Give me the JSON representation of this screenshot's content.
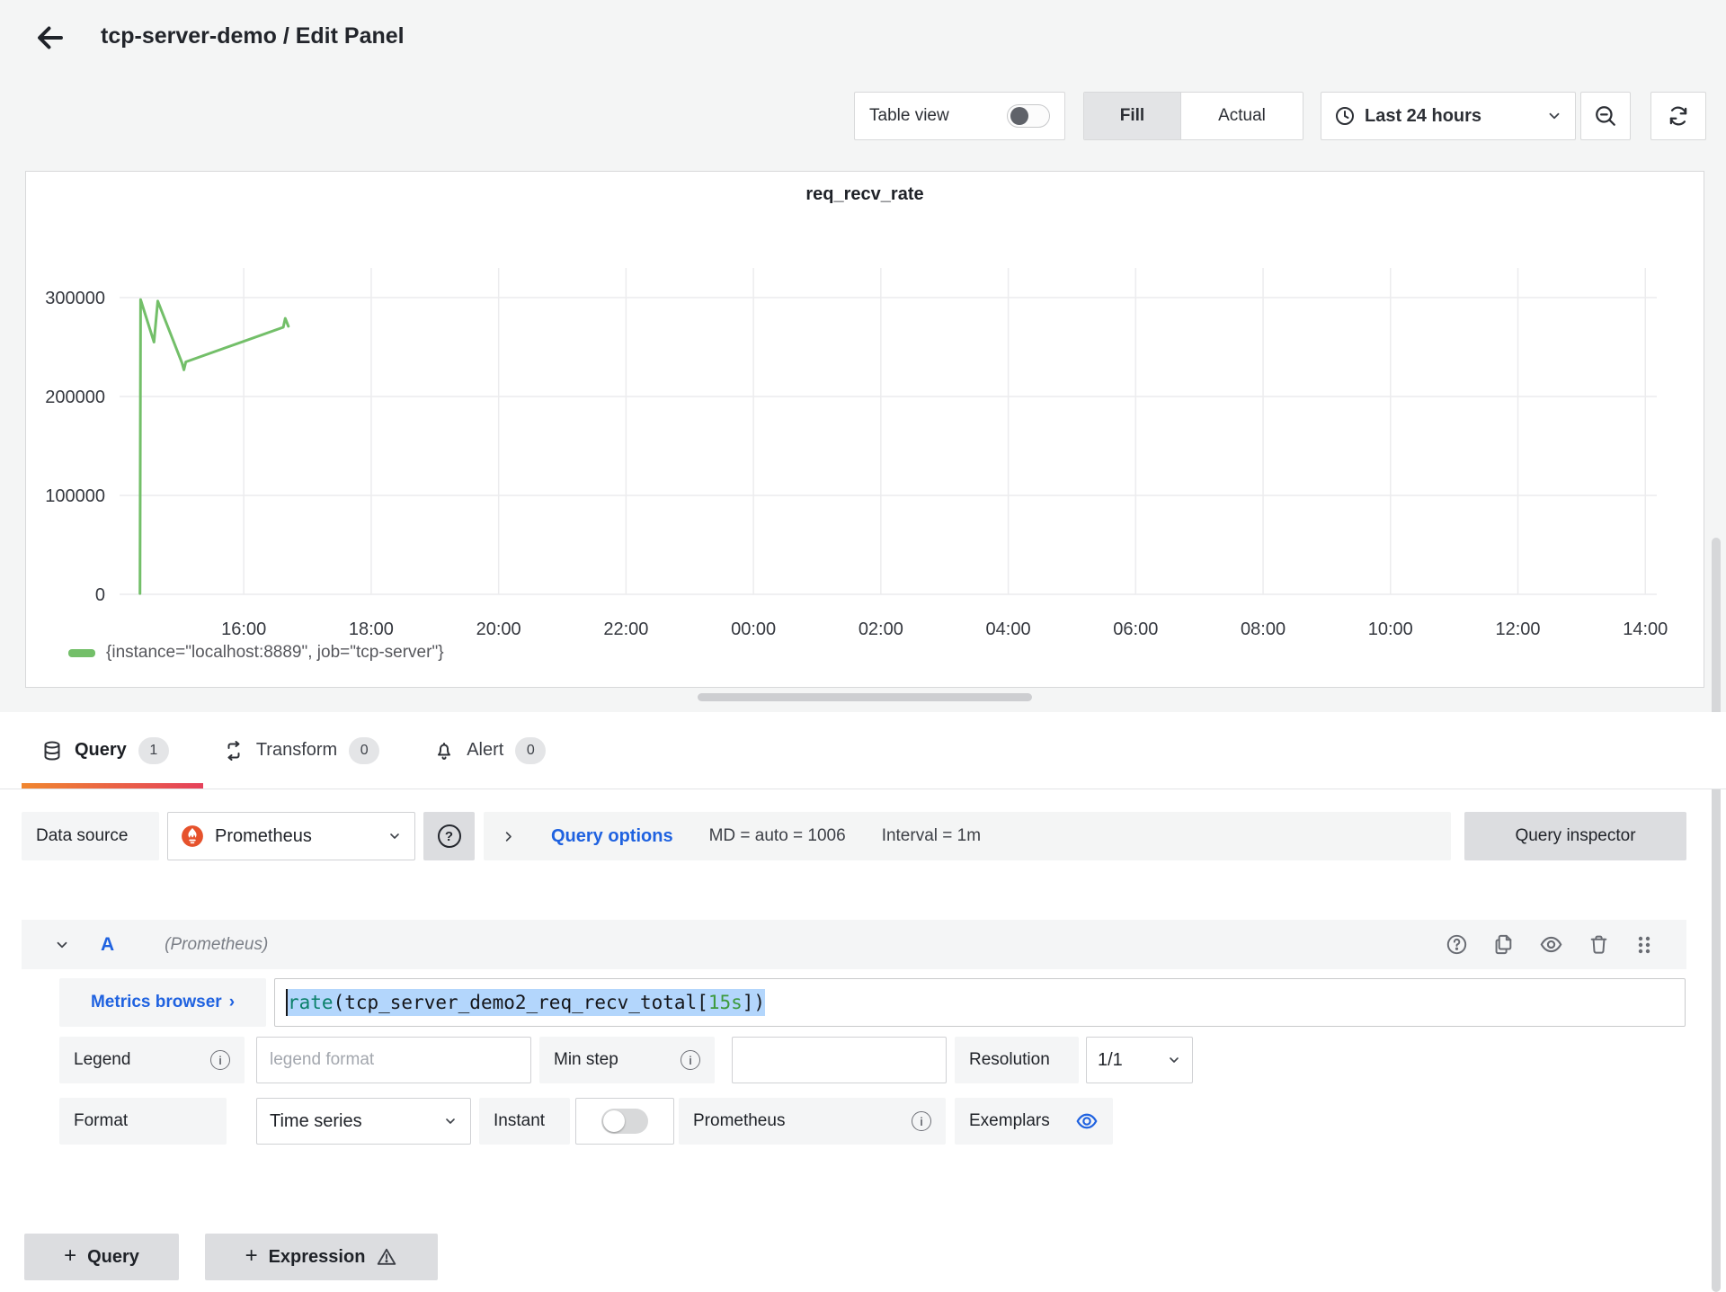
{
  "header": {
    "title": "tcp-server-demo / Edit Panel"
  },
  "toolbar": {
    "table_view_label": "Table view",
    "fill_label": "Fill",
    "actual_label": "Actual",
    "time_range_label": "Last 24 hours"
  },
  "chart_data": {
    "type": "line",
    "title": "req_recv_rate",
    "xlabel": "",
    "ylabel": "",
    "grid": true,
    "legend_position": "bottom",
    "x_range": [
      14.05,
      38.18
    ],
    "y_range": [
      0,
      330000
    ],
    "x_ticks": [
      {
        "h": 16,
        "label": "16:00"
      },
      {
        "h": 18,
        "label": "18:00"
      },
      {
        "h": 20,
        "label": "20:00"
      },
      {
        "h": 22,
        "label": "22:00"
      },
      {
        "h": 24,
        "label": "00:00"
      },
      {
        "h": 26,
        "label": "02:00"
      },
      {
        "h": 28,
        "label": "04:00"
      },
      {
        "h": 30,
        "label": "06:00"
      },
      {
        "h": 32,
        "label": "08:00"
      },
      {
        "h": 34,
        "label": "10:00"
      },
      {
        "h": 36,
        "label": "12:00"
      },
      {
        "h": 38,
        "label": "14:00"
      }
    ],
    "y_ticks": [
      {
        "v": 0,
        "label": "0"
      },
      {
        "v": 100000,
        "label": "100000"
      },
      {
        "v": 200000,
        "label": "200000"
      },
      {
        "v": 300000,
        "label": "300000"
      }
    ],
    "series": [
      {
        "name": "{instance=\"localhost:8889\", job=\"tcp-server\"}",
        "color": "#73bf69",
        "points": [
          {
            "h": 14.37,
            "v": 800
          },
          {
            "h": 14.38,
            "v": 298000
          },
          {
            "h": 14.59,
            "v": 255000
          },
          {
            "h": 14.65,
            "v": 296500
          },
          {
            "h": 15.03,
            "v": 234000
          },
          {
            "h": 15.06,
            "v": 227000
          },
          {
            "h": 15.09,
            "v": 235000
          },
          {
            "h": 16.62,
            "v": 270000
          },
          {
            "h": 16.65,
            "v": 279000
          },
          {
            "h": 16.7,
            "v": 271000
          }
        ]
      }
    ]
  },
  "tabs": {
    "query": {
      "label": "Query",
      "count": "1"
    },
    "transform": {
      "label": "Transform",
      "count": "0"
    },
    "alert": {
      "label": "Alert",
      "count": "0"
    }
  },
  "datasource_row": {
    "label": "Data source",
    "value": "Prometheus",
    "query_options_label": "Query options",
    "md_text": "MD = auto = 1006",
    "interval_text": "Interval = 1m",
    "inspector_label": "Query inspector"
  },
  "query_editor": {
    "ref_id": "A",
    "datasource_hint": "(Prometheus)",
    "metrics_browser_label": "Metrics browser",
    "metrics_browser_chevron": "›",
    "expr": {
      "fn": "rate",
      "open": "(tcp_server_demo2_req_recv_total[",
      "duration": "15s",
      "close": "])"
    },
    "legend_label": "Legend",
    "legend_placeholder": "legend format",
    "min_step_label": "Min step",
    "resolution_label": "Resolution",
    "resolution_value": "1/1",
    "format_label": "Format",
    "format_value": "Time series",
    "instant_label": "Instant",
    "prometheus_label": "Prometheus",
    "exemplars_label": "Exemplars"
  },
  "footer": {
    "add_query_label": "Query",
    "add_expression_label": "Expression"
  },
  "icons": {
    "help": "?",
    "info": "i"
  },
  "colors": {
    "accent_blue": "#1f62e0",
    "series_green": "#73bf69",
    "selection_blue": "#b3d6fc",
    "tab_gradient_start": "#f0862f",
    "tab_gradient_end": "#e5415b",
    "prometheus_orange": "#e6522c",
    "token_function": "#0b806a",
    "token_duration": "#3d9a3d",
    "panel_background": "#ffffff",
    "page_background": "#f4f5f5"
  }
}
